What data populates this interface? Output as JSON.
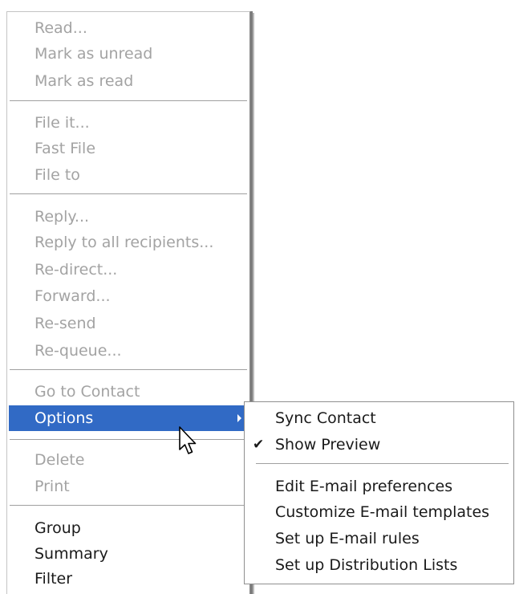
{
  "context_menu": {
    "groups": [
      {
        "items": [
          {
            "label": "Read...",
            "enabled": false
          },
          {
            "label": "Mark as unread",
            "enabled": false
          },
          {
            "label": "Mark as read",
            "enabled": false
          }
        ]
      },
      {
        "items": [
          {
            "label": "File it...",
            "enabled": false
          },
          {
            "label": "Fast File",
            "enabled": false
          },
          {
            "label": "File to",
            "enabled": false
          }
        ]
      },
      {
        "items": [
          {
            "label": "Reply...",
            "enabled": false
          },
          {
            "label": "Reply to all recipients...",
            "enabled": false
          },
          {
            "label": "Re-direct...",
            "enabled": false
          },
          {
            "label": "Forward...",
            "enabled": false
          },
          {
            "label": "Re-send",
            "enabled": false
          },
          {
            "label": "Re-queue...",
            "enabled": false
          }
        ]
      },
      {
        "items": [
          {
            "label": "Go to Contact",
            "enabled": false
          },
          {
            "label": "Options",
            "enabled": true,
            "selected": true,
            "has_submenu": true
          }
        ]
      },
      {
        "items": [
          {
            "label": "Delete",
            "enabled": false
          },
          {
            "label": "Print",
            "enabled": false
          }
        ]
      },
      {
        "items": [
          {
            "label": "Group",
            "enabled": true
          },
          {
            "label": "Summary",
            "enabled": true
          },
          {
            "label": "Filter",
            "enabled": true
          }
        ]
      }
    ]
  },
  "options_submenu": {
    "items": [
      {
        "label": "Sync Contact",
        "checked": false
      },
      {
        "label": "Show Preview",
        "checked": true
      },
      {
        "label": "Edit E-mail preferences",
        "checked": false
      },
      {
        "label": "Customize E-mail templates",
        "checked": false
      },
      {
        "label": "Set up E-mail rules",
        "checked": false
      },
      {
        "label": "Set up Distribution Lists",
        "checked": false
      }
    ],
    "check_glyph": "✔"
  },
  "colors": {
    "selection_background": "#316ac5",
    "selection_text": "#ffffff",
    "disabled_text": "#a3a3a3",
    "enabled_text": "#1a1a1a"
  },
  "icons": {
    "submenu_arrow": "submenu-arrow-icon",
    "check": "check-icon",
    "mouse_cursor": "mouse-pointer-icon"
  }
}
